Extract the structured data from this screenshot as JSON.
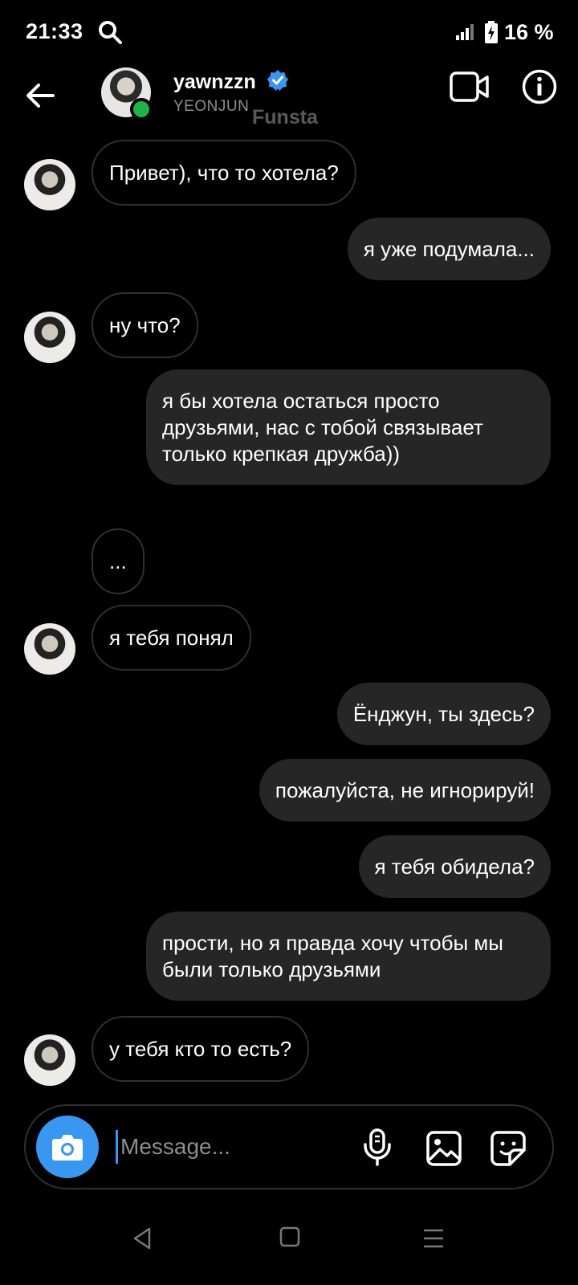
{
  "status_bar": {
    "time": "21:33",
    "battery": "16 %"
  },
  "header": {
    "username": "yawnzzn",
    "subname": "YEONJUN",
    "watermark": "Funsta",
    "accent": "#3897f0",
    "online_color": "#1fb34b"
  },
  "messages": [
    {
      "side": "in",
      "text": "Привет), что то хотела?",
      "avatar": true
    },
    {
      "side": "out",
      "text": "я уже подумала..."
    },
    {
      "side": "in",
      "text": "ну что?",
      "avatar": true
    },
    {
      "side": "out",
      "text": "я бы хотела остаться просто друзьями, нас с тобой связывает только крепкая дружба))"
    },
    {
      "side": "in",
      "text": "...",
      "avatar": false
    },
    {
      "side": "in",
      "text": "я тебя понял",
      "avatar": true
    },
    {
      "side": "out",
      "text": "Ёнджун, ты здесь?"
    },
    {
      "side": "out",
      "text": "пожалуйста, не игнорируй!"
    },
    {
      "side": "out",
      "text": "я тебя обидела?"
    },
    {
      "side": "out",
      "text": "прости, но я правда хочу чтобы мы были только друзьями"
    },
    {
      "side": "in",
      "text": "у тебя кто то есть?",
      "avatar": true
    }
  ],
  "composer": {
    "placeholder": "Message..."
  },
  "icons": [
    "search-icon",
    "signal-icon",
    "battery-icon",
    "back-arrow-icon",
    "verified-badge-icon",
    "video-call-icon",
    "info-icon",
    "camera-icon",
    "microphone-icon",
    "gallery-icon",
    "sticker-icon",
    "nav-back-icon",
    "nav-home-icon",
    "nav-menu-icon"
  ]
}
